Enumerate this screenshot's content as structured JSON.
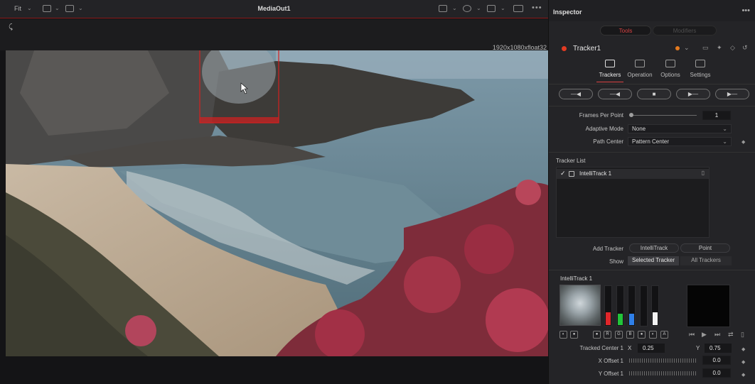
{
  "viewer": {
    "fit_label": "Fit",
    "title": "MediaOut1",
    "more": "•••",
    "resolution": "1920x1080xfloat32"
  },
  "inspector": {
    "title": "Inspector",
    "more": "•••",
    "segments": [
      "Tools",
      "Modifiers"
    ],
    "node_name": "Tracker1",
    "tabs": [
      "Trackers",
      "Operation",
      "Options",
      "Settings"
    ],
    "active_tab": "Trackers"
  },
  "track_buttons": [
    {
      "label": "—◀",
      "icon": "track-reverse-from-end-icon"
    },
    {
      "label": "—◀",
      "icon": "track-reverse-icon"
    },
    {
      "label": "■",
      "icon": "stop-icon"
    },
    {
      "label": "▶—",
      "icon": "track-forward-icon"
    },
    {
      "label": "▶—",
      "icon": "track-forward-to-end-icon"
    }
  ],
  "params": {
    "frames_per_point_label": "Frames Per Point",
    "frames_per_point_value": "1",
    "adaptive_mode_label": "Adaptive Mode",
    "adaptive_mode_value": "None",
    "path_center_label": "Path Center",
    "path_center_value": "Pattern Center"
  },
  "tracker_list": {
    "label": "Tracker List",
    "items": [
      {
        "name": "IntelliTrack 1",
        "checked": "✓"
      }
    ]
  },
  "add_tracker": {
    "label": "Add Tracker",
    "options": [
      "IntelliTrack",
      "Point"
    ]
  },
  "show": {
    "label": "Show",
    "options": [
      "Selected Tracker",
      "All Trackers"
    ]
  },
  "intellitrack": {
    "title": "IntelliTrack 1",
    "channel_chips": [
      "R",
      "G",
      "B",
      "A"
    ],
    "meter_colors": [
      "#e0262a",
      "#22c43a",
      "#2f7fe8",
      "#f2f2f2"
    ]
  },
  "tracked_center": {
    "label": "Tracked Center 1",
    "x_label": "X",
    "x_value": "0.25",
    "y_label": "Y",
    "y_value": "0.75"
  },
  "x_offset": {
    "label": "X Offset 1",
    "value": "0.0"
  },
  "y_offset": {
    "label": "Y Offset 1",
    "value": "0.0"
  },
  "colors": {
    "accent_red": "#d94343",
    "node_dot": "#e33b22",
    "node_orange": "#e57a1e"
  }
}
